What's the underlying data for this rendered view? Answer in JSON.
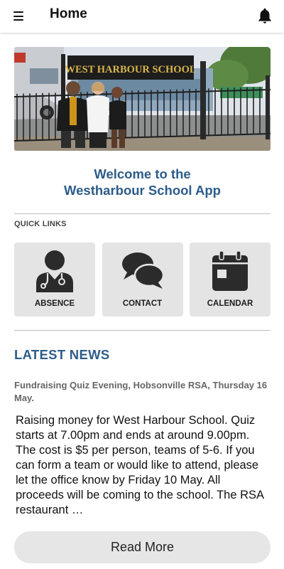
{
  "header": {
    "menu_icon": "hamburger-menu-icon",
    "title": "Home",
    "notification_icon": "bell-icon"
  },
  "hero": {
    "sign_text": "WEST HARBOUR SCHOOL"
  },
  "welcome": {
    "line1": "Welcome to the",
    "line2": "Westharbour School App"
  },
  "quick_links": {
    "label": "QUICK LINKS",
    "items": [
      {
        "label": "ABSENCE",
        "icon": "doctor-icon"
      },
      {
        "label": "CONTACT",
        "icon": "chat-bubbles-icon"
      },
      {
        "label": "CALENDAR",
        "icon": "calendar-icon"
      }
    ]
  },
  "news": {
    "heading": "LATEST NEWS",
    "title": "Fundraising Quiz Evening, Hobsonville RSA, Thursday 16 May.",
    "body": "Raising money for West Harbour School.  Quiz starts at 7.00pm and ends at around 9.00pm.  The cost is $5 per person, teams of 5-6.  If you can form a team or would like to attend, please let the office know by Friday 10 May.  All proceeds will be coming to the school.  The RSA restaurant …",
    "read_more": "Read More"
  },
  "colors": {
    "accent": "#2c5c8a",
    "tile_background": "#e4e4e4",
    "button_background": "#e6e6e6",
    "divider": "#bdbdbd"
  }
}
